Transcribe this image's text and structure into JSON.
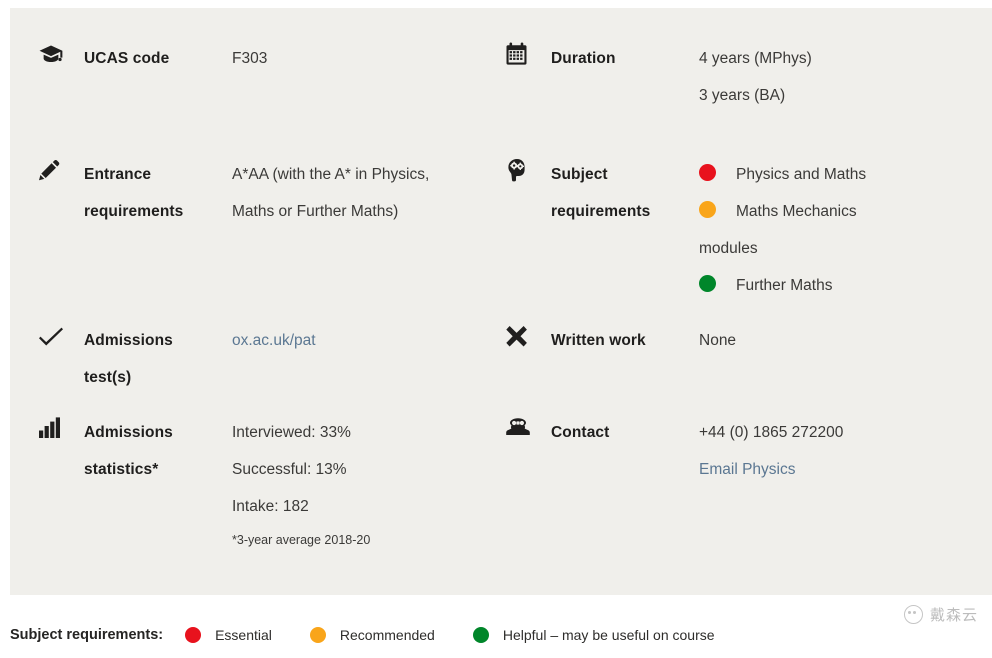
{
  "panel": {
    "background_color": "#f0efeb"
  },
  "colors": {
    "essential": "#e8121d",
    "recommended": "#f9a51a",
    "helpful": "#00862a",
    "link": "#5b7792",
    "text": "#3b3a38"
  },
  "facts": {
    "ucas_code": {
      "icon": "graduation-cap-icon",
      "label": "UCAS code",
      "values": [
        "F303"
      ]
    },
    "duration": {
      "icon": "calendar-icon",
      "label": "Duration",
      "values": [
        "4 years (MPhys)",
        "3 years (BA)"
      ]
    },
    "entrance_requirements": {
      "icon": "pencil-icon",
      "label_line1": "Entrance",
      "label_line2": "requirements",
      "values": [
        "A*AA (with the A* in Physics,",
        "Maths or Further Maths)"
      ]
    },
    "subject_requirements": {
      "icon": "head-cogs-icon",
      "label_line1": "Subject",
      "label_line2": "requirements",
      "items": [
        {
          "dot": "#e8121d",
          "text": "Physics and Maths"
        },
        {
          "dot": "#f9a51a",
          "text": "Maths Mechanics"
        },
        {
          "dot": null,
          "text": "modules"
        },
        {
          "dot": "#00862a",
          "text": "Further Maths"
        }
      ]
    },
    "admissions_tests": {
      "icon": "check-icon",
      "label_line1": "Admissions",
      "label_line2": "test(s)",
      "link_text": "ox.ac.uk/pat"
    },
    "written_work": {
      "icon": "cross-icon",
      "label": "Written work",
      "values": [
        "None"
      ]
    },
    "admissions_statistics": {
      "icon": "bar-chart-icon",
      "label_line1": "Admissions",
      "label_line2": "statistics*",
      "values": [
        "Interviewed: 33%",
        "Successful: 13%",
        "Intake: 182"
      ],
      "footnote": "*3-year average 2018-20"
    },
    "contact": {
      "icon": "telephone-icon",
      "label": "Contact",
      "phone": "+44 (0) 1865 272200",
      "email_link_text": "Email Physics"
    }
  },
  "legend": {
    "title": "Subject requirements:",
    "items": [
      {
        "color": "#e8121d",
        "label": "Essential"
      },
      {
        "color": "#f9a51a",
        "label": "Recommended"
      },
      {
        "color": "#00862a",
        "label": "Helpful – may be useful on course"
      }
    ]
  },
  "watermark": {
    "text": "戴森云"
  }
}
